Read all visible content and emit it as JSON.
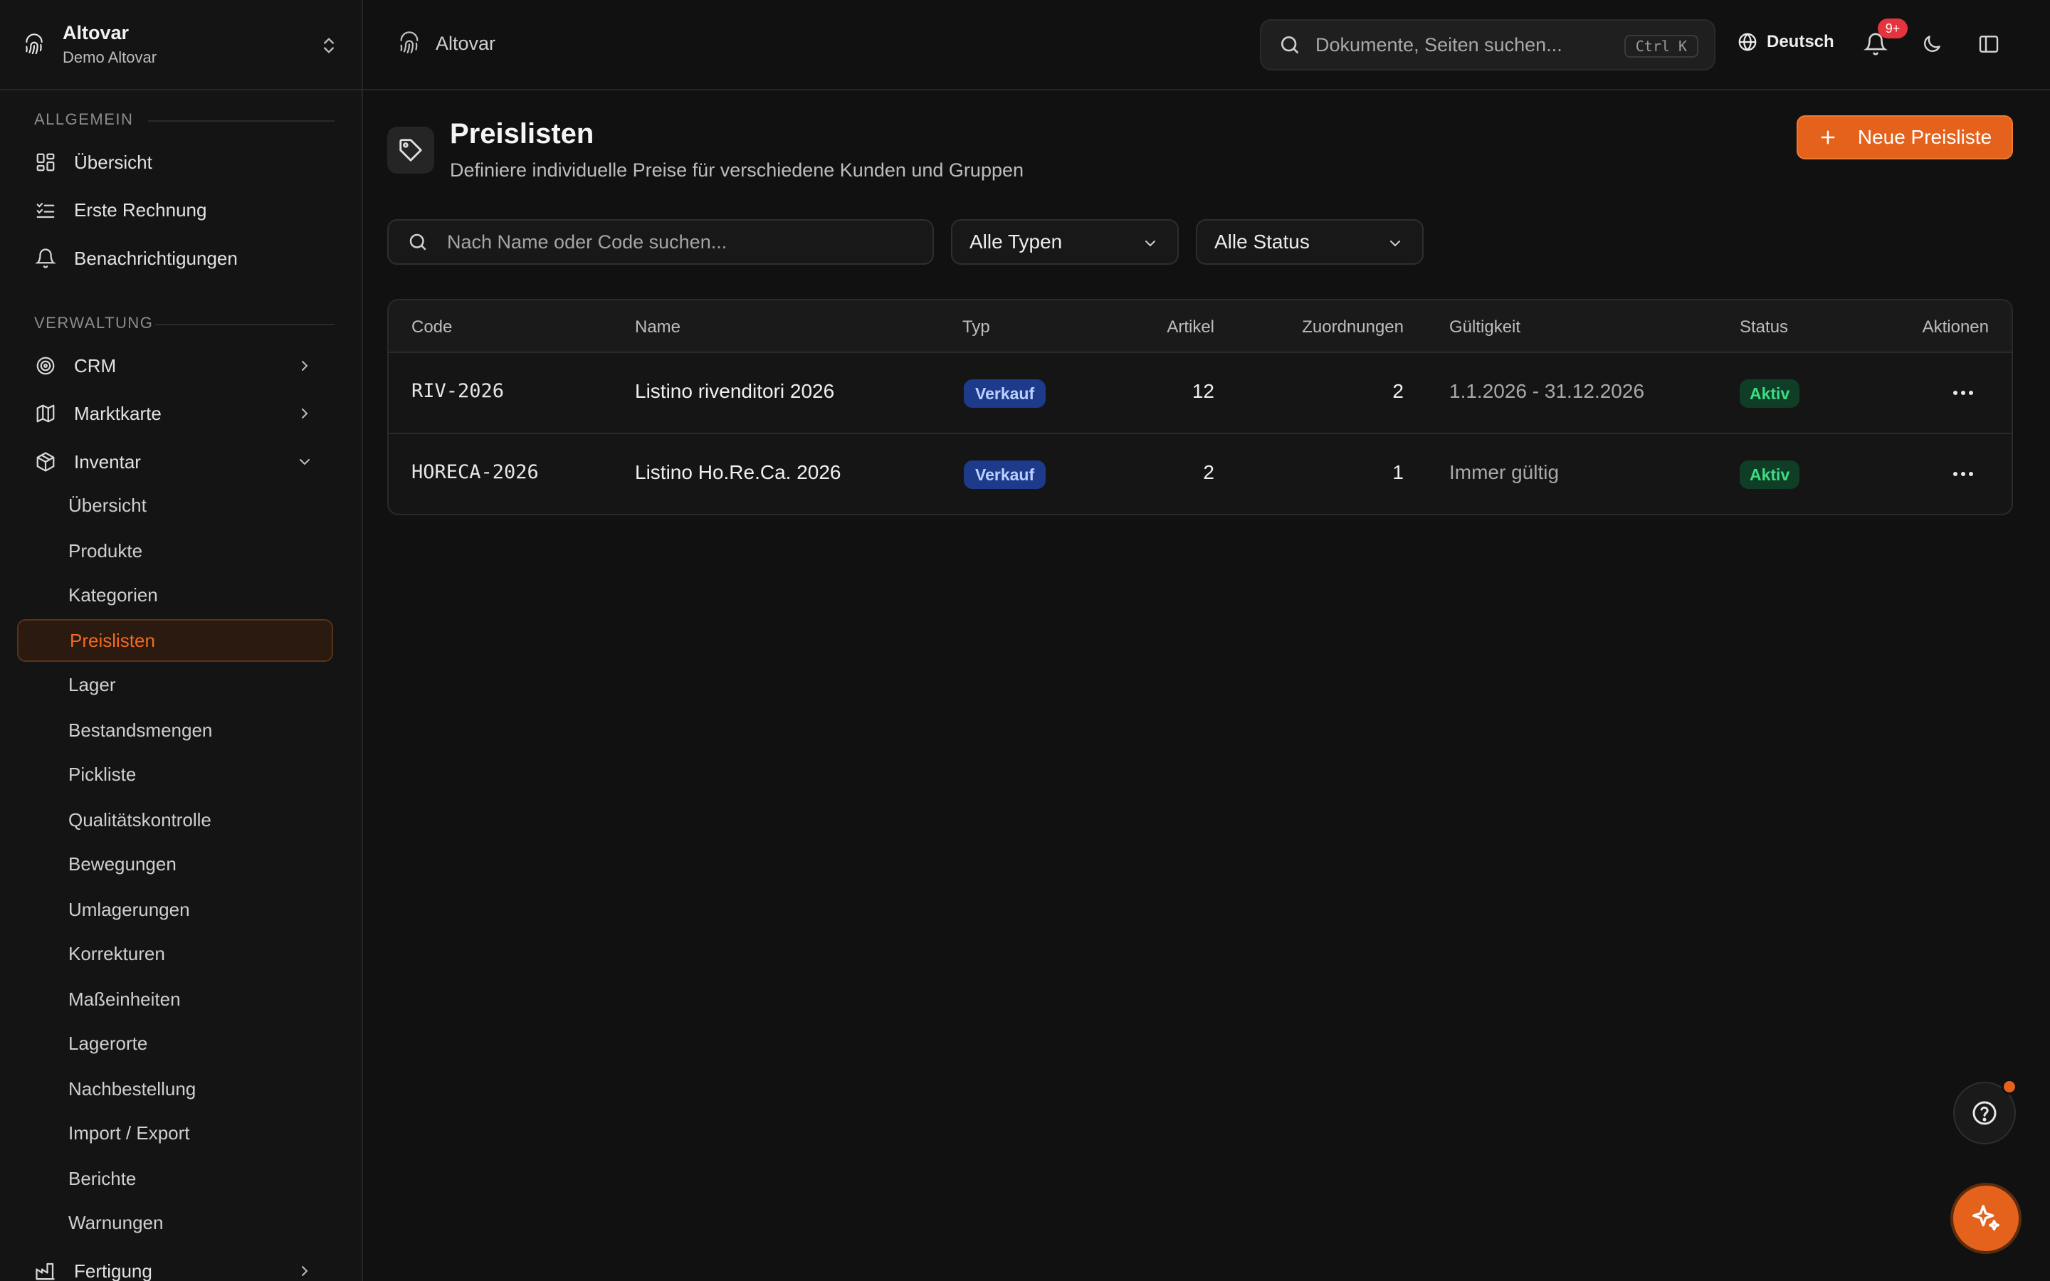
{
  "workspace": {
    "name": "Altovar",
    "subtitle": "Demo Altovar"
  },
  "sidebar": {
    "section_general": "ALLGEMEIN",
    "section_admin": "VERWALTUNG",
    "general_items": [
      {
        "label": "Übersicht",
        "icon": "dashboard-icon"
      },
      {
        "label": "Erste Rechnung",
        "icon": "checklist-icon"
      },
      {
        "label": "Benachrichtigungen",
        "icon": "bell-icon"
      }
    ],
    "admin_items": [
      {
        "label": "CRM",
        "icon": "target-icon"
      },
      {
        "label": "Marktkarte",
        "icon": "map-icon"
      },
      {
        "label": "Inventar",
        "icon": "box-icon"
      }
    ],
    "inventory_sub": [
      "Übersicht",
      "Produkte",
      "Kategorien",
      "Preislisten",
      "Lager",
      "Bestandsmengen",
      "Pickliste",
      "Qualitätskontrolle",
      "Bewegungen",
      "Umlagerungen",
      "Korrekturen",
      "Maßeinheiten",
      "Lagerorte",
      "Nachbestellung",
      "Import / Export",
      "Berichte",
      "Warnungen"
    ],
    "active_sub": "Preislisten",
    "last_item": {
      "label": "Fertigung",
      "icon": "factory-icon"
    }
  },
  "topbar": {
    "breadcrumb": "Altovar",
    "search_placeholder": "Dokumente, Seiten suchen...",
    "shortcut": "Ctrl K",
    "language": "Deutsch",
    "notification_count": "9+"
  },
  "page": {
    "title": "Preislisten",
    "subtitle": "Definiere individuelle Preise für verschiedene Kunden und Gruppen",
    "new_button": "Neue Preisliste"
  },
  "filters": {
    "search_placeholder": "Nach Name oder Code suchen...",
    "type_select": "Alle Typen",
    "status_select": "Alle Status"
  },
  "table": {
    "headers": [
      "Code",
      "Name",
      "Typ",
      "Artikel",
      "Zuordnungen",
      "Gültigkeit",
      "Status",
      "Aktionen"
    ],
    "rows": [
      {
        "code": "RIV-2026",
        "name": "Listino rivenditori 2026",
        "typ": "Verkauf",
        "artikel": "12",
        "zuordnungen": "2",
        "gueltigkeit": "1.1.2026 - 31.12.2026",
        "status": "Aktiv"
      },
      {
        "code": "HORECA-2026",
        "name": "Listino Ho.Re.Ca. 2026",
        "typ": "Verkauf",
        "artikel": "2",
        "zuordnungen": "1",
        "gueltigkeit": "Immer gültig",
        "status": "Aktiv"
      }
    ]
  },
  "colors": {
    "accent": "#e4621b",
    "background": "#111111",
    "badge_blue": "#1e3a8a",
    "status_green": "#3ddc84"
  }
}
